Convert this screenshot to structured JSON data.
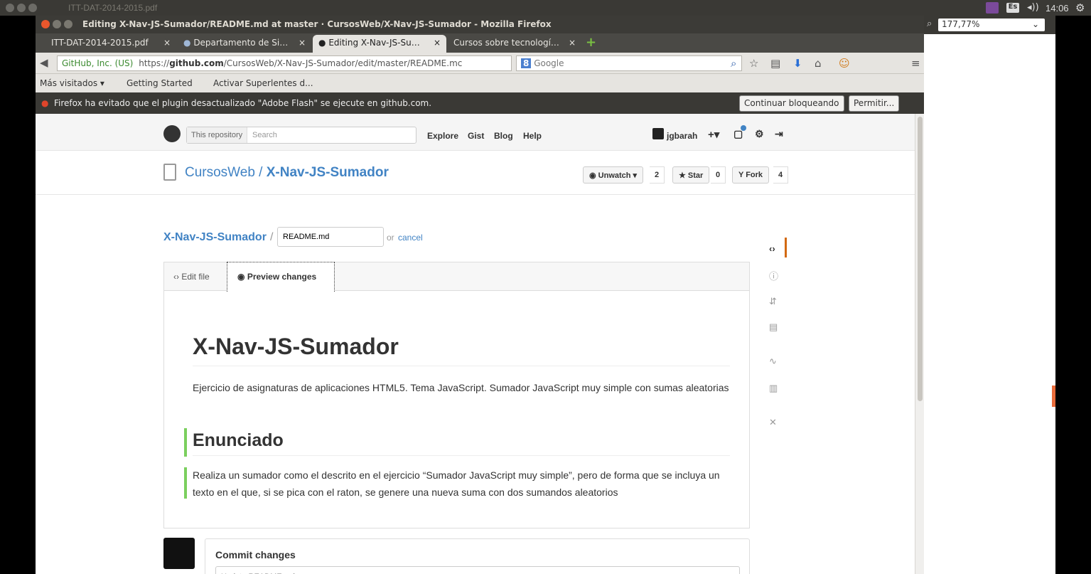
{
  "desktop": {
    "window_title": "ITT-DAT-2014-2015.pdf",
    "clock": "14:06",
    "lang": "Es",
    "zoom": "177,77%"
  },
  "firefox": {
    "title": "Editing X-Nav-JS-Sumador/README.md at master · CursosWeb/X-Nav-JS-Sumador - Mozilla Firefox",
    "tabs": [
      {
        "label": "ITT-DAT-2014-2015.pdf"
      },
      {
        "label": "Departamento de Si…"
      },
      {
        "label": "Editing X-Nav-JS-Su…"
      },
      {
        "label": "Cursos sobre tecnologí…"
      }
    ],
    "url_identity": "GitHub, Inc. (US)",
    "url_prefix": "https://",
    "url_host": "github.com",
    "url_path": "/CursosWeb/X-Nav-JS-Sumador/edit/master/README.mc",
    "search_placeholder": "Google",
    "bookmarks": [
      "Más visitados ▾",
      "Getting Started",
      "Activar Superlentes d..."
    ],
    "notification": "Firefox ha evitado que el plugin desactualizado \"Adobe Flash\" se ejecute en github.com.",
    "btn_continue": "Continuar bloqueando",
    "btn_allow": "Permitir..."
  },
  "github": {
    "search_scope": "This repository",
    "search_placeholder": "Search",
    "nav": [
      "Explore",
      "Gist",
      "Blog",
      "Help"
    ],
    "user": "jgbarah",
    "repo_owner": "CursosWeb",
    "repo_sep": " / ",
    "repo_name": "X-Nav-JS-Sumador",
    "unwatch_label": "Unwatch ▾",
    "unwatch_count": "2",
    "star_label": "Star",
    "star_count": "0",
    "fork_label": "Fork",
    "fork_count": "4",
    "breadcrumb_repo": "X-Nav-JS-Sumador",
    "breadcrumb_sep": "/",
    "filename": "README.md",
    "or_text": "or",
    "cancel_text": "cancel",
    "tab_edit": "Edit file",
    "tab_preview": "Preview changes",
    "preview": {
      "h1": "X-Nav-JS-Sumador",
      "p1": "Ejercicio de asignaturas de aplicaciones HTML5. Tema JavaScript. Sumador JavaScript muy simple con sumas aleatorias",
      "h2": "Enunciado",
      "p2": "Realiza un sumador como el descrito en el ejercicio “Sumador JavaScript muy simple”, pero de forma que se incluya un texto en el que, si se pica con el raton, se genere una nueva suma con dos sumandos aleatorios"
    },
    "commit_title": "Commit changes",
    "commit_placeholder": "Update README.md"
  }
}
